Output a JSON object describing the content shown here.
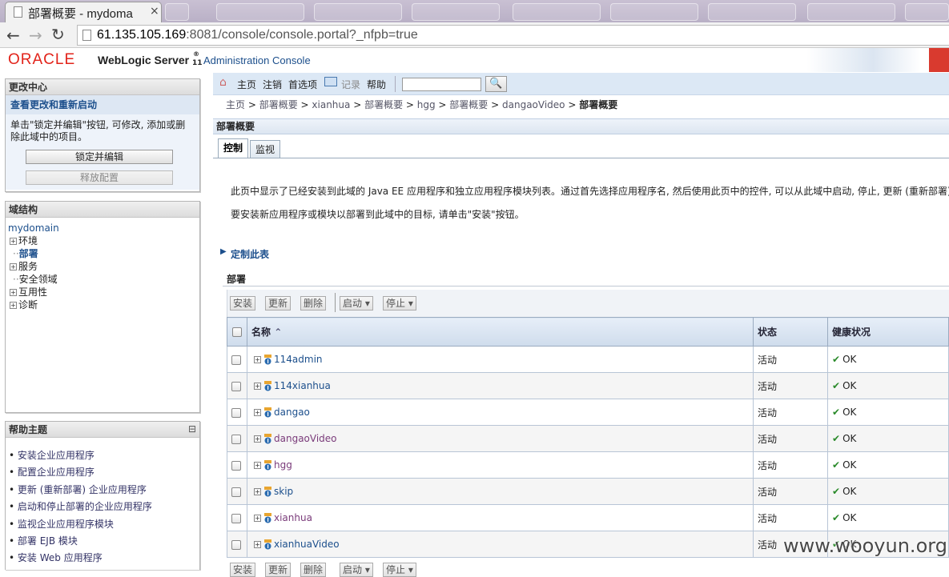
{
  "browser": {
    "active_tab_title": "部署概要 - mydoma",
    "url_host": "61.135.105.169",
    "url_rest": ":8081/console/console.portal?_nfpb=true"
  },
  "banner": {
    "oracle": "ORACLE",
    "product": "WebLogic Server",
    "reg": "®",
    "version": "11",
    "console": "Administration Console"
  },
  "change_center": {
    "title": "更改中心",
    "subtitle": "查看更改和重新启动",
    "description": "单击\"锁定并编辑\"按钮, 可修改, 添加或删除此域中的项目。",
    "lock_button": "锁定并编辑",
    "release_button": "释放配置"
  },
  "domain_structure": {
    "title": "域结构",
    "root": "mydomain",
    "items": [
      {
        "label": "环境",
        "expandable": true
      },
      {
        "label": "部署",
        "expandable": false,
        "selected": true
      },
      {
        "label": "服务",
        "expandable": true
      },
      {
        "label": "安全领域",
        "expandable": false
      },
      {
        "label": "互用性",
        "expandable": true
      },
      {
        "label": "诊断",
        "expandable": true
      }
    ]
  },
  "help": {
    "title": "帮助主题",
    "collapse": "⊟",
    "items": [
      "安装企业应用程序",
      "配置企业应用程序",
      "更新 (重新部署) 企业应用程序",
      "启动和停止部署的企业应用程序",
      "监视企业应用程序模块",
      "部署 EJB 模块",
      "安装 Web 应用程序"
    ]
  },
  "toolbar": {
    "home": "主页",
    "logout": "注销",
    "prefs": "首选项",
    "record": "记录",
    "help": "帮助",
    "search_value": ""
  },
  "breadcrumb": [
    "主页",
    "部署概要",
    "xianhua",
    "部署概要",
    "hgg",
    "部署概要",
    "dangaoVideo",
    "部署概要"
  ],
  "page": {
    "title": "部署概要",
    "tabs": [
      "控制",
      "监视"
    ],
    "intro1": "此页中显示了已经安装到此域的 Java EE 应用程序和独立应用程序模块列表。通过首先选择应用程序名, 然后使用此页中的控件, 可以从此域中启动, 停止, 更新 (重新部署)",
    "intro2": "要安装新应用程序或模块以部署到此域中的目标, 请单击\"安装\"按钮。",
    "customize": "定制此表",
    "section": "部署"
  },
  "table_buttons": {
    "install": "安装",
    "update": "更新",
    "delete": "删除",
    "start": "启动",
    "stop": "停止"
  },
  "table": {
    "headers": {
      "name": "名称",
      "state": "状态",
      "health": "健康状况"
    },
    "rows": [
      {
        "name": "114admin",
        "state": "活动",
        "health": "OK"
      },
      {
        "name": "114xianhua",
        "state": "活动",
        "health": "OK"
      },
      {
        "name": "dangao",
        "state": "活动",
        "health": "OK"
      },
      {
        "name": "dangaoVideo",
        "state": "活动",
        "health": "OK"
      },
      {
        "name": "hgg",
        "state": "活动",
        "health": "OK"
      },
      {
        "name": "skip",
        "state": "活动",
        "health": "OK"
      },
      {
        "name": "xianhua",
        "state": "活动",
        "health": "OK"
      },
      {
        "name": "xianhuaVideo",
        "state": "活动",
        "health": "OK"
      }
    ]
  },
  "watermark": "www.wooyun.org",
  "colors": {
    "oracle_red": "#e2231a",
    "link_blue": "#1c4f8c",
    "header_bg": "#dce8f5"
  }
}
